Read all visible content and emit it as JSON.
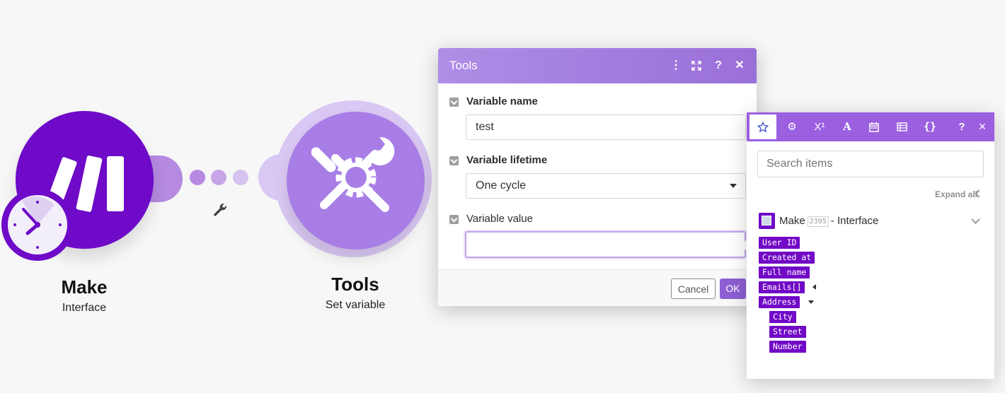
{
  "canvas": {
    "make_module": {
      "title": "Make",
      "subtitle": "Interface",
      "color": "#6e0ac8"
    },
    "tools_module": {
      "title": "Tools",
      "subtitle": "Set variable",
      "color": "#a87ee6"
    },
    "connector_icon": "wrench-icon",
    "trigger_icon": "clock-icon"
  },
  "dialog": {
    "title": "Tools",
    "header_icons": [
      "more-vertical-icon",
      "expand-icon",
      "help-icon",
      "close-icon"
    ],
    "fields": [
      {
        "label": "Variable name",
        "value": "test"
      },
      {
        "label": "Variable lifetime",
        "value": "One cycle"
      },
      {
        "label": "Variable value",
        "value": ""
      }
    ],
    "cancel_label": "Cancel",
    "ok_label": "OK",
    "accent": "#8d5fd3"
  },
  "panel": {
    "tabs": [
      "star-icon",
      "gear-icon",
      "superscript-icon",
      "text-icon",
      "calendar-icon",
      "table-icon",
      "braces-icon",
      "help-icon",
      "close-icon"
    ],
    "tab_labels": {
      "superscript": "X¹",
      "text": "A",
      "braces": "{}",
      "help": "?",
      "close": "×"
    },
    "search_placeholder": "Search items",
    "expand_all": "Expand all",
    "source": {
      "name": "Make",
      "badge": "2395",
      "suffix": "- Interface"
    },
    "items": [
      {
        "label": "User ID"
      },
      {
        "label": "Created at"
      },
      {
        "label": "Full name"
      },
      {
        "label": "Emails[]",
        "toggle": "collapsed"
      },
      {
        "label": "Address",
        "toggle": "expanded",
        "children": [
          {
            "label": "City"
          },
          {
            "label": "Street"
          },
          {
            "label": "Number"
          }
        ]
      }
    ],
    "tab_bar_color": "#9b5fe0",
    "pill_color": "#7109c6"
  }
}
